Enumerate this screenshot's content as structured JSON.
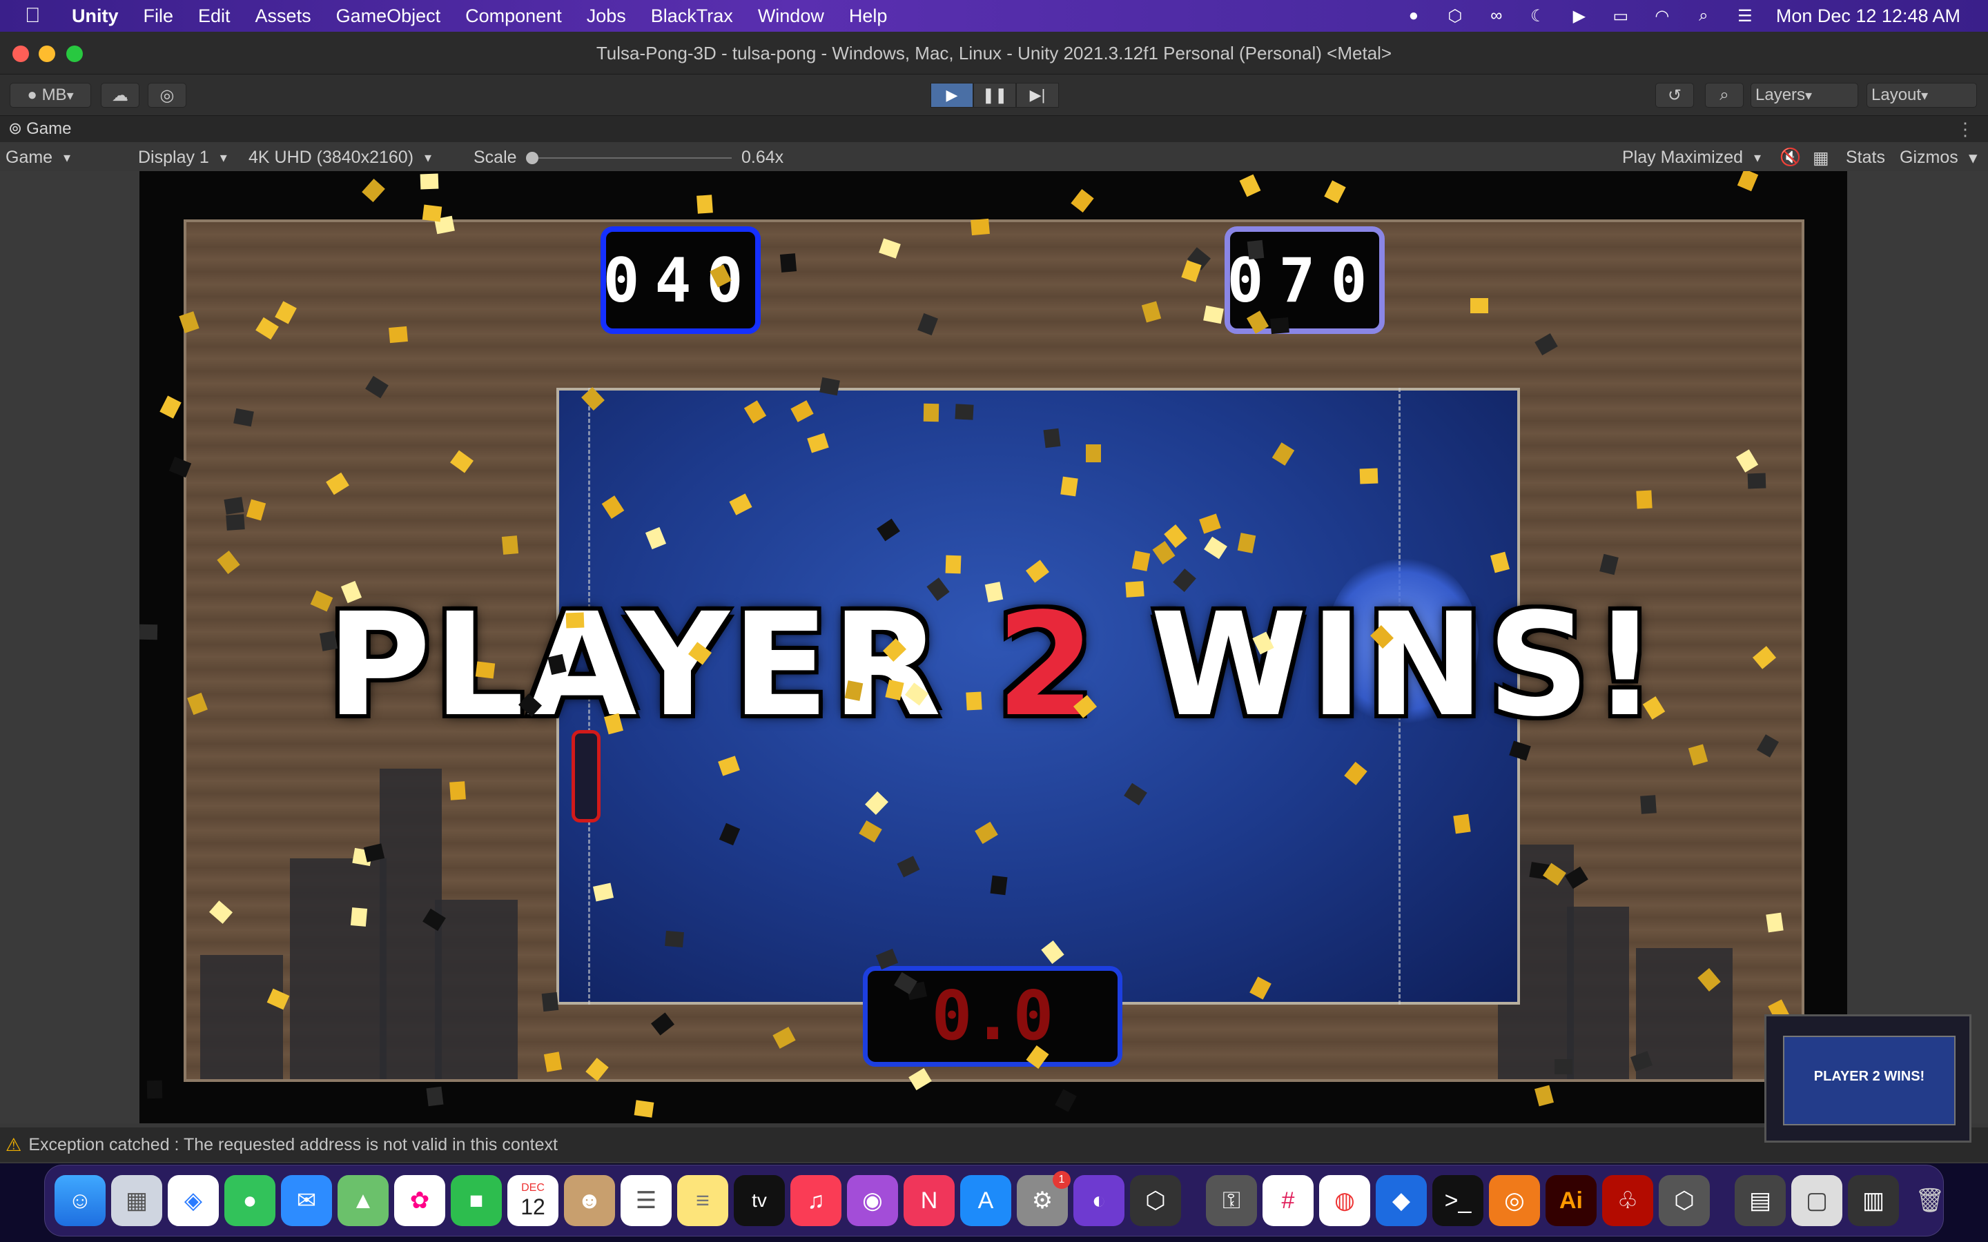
{
  "menubar": {
    "app": "Unity",
    "items": [
      "File",
      "Edit",
      "Assets",
      "GameObject",
      "Component",
      "Jobs",
      "BlackTrax",
      "Window",
      "Help"
    ],
    "clock": "Mon Dec 12  12:48 AM"
  },
  "window": {
    "title": "Tulsa-Pong-3D - tulsa-pong - Windows, Mac, Linux - Unity 2021.3.12f1 Personal (Personal) <Metal>"
  },
  "toolbar": {
    "account": "MB",
    "layers": "Layers",
    "layout": "Layout"
  },
  "tabs": {
    "game": "Game"
  },
  "gamebar": {
    "view": "Game",
    "display": "Display 1",
    "resolution": "4K UHD (3840x2160)",
    "scale_label": "Scale",
    "scale_value": "0.64x",
    "play_mode": "Play Maximized",
    "stats": "Stats",
    "gizmos": "Gizmos"
  },
  "game": {
    "player1_score": "040",
    "player2_score": "070",
    "timer": "0.0",
    "banner_before": "PLAYER ",
    "banner_num": "2",
    "banner_after": " WINS!"
  },
  "status": {
    "message": "Exception catched : The requested address is not valid in this context"
  },
  "preview": {
    "text": "PLAYER 2 WINS!"
  },
  "dock": {
    "apps": [
      "finder-icon",
      "launchpad-icon",
      "safari-icon",
      "messages-icon",
      "mail-icon",
      "maps-icon",
      "photos-icon",
      "facetime-icon",
      "calendar-icon",
      "contacts-icon",
      "reminders-icon",
      "notes-icon",
      "tv-icon",
      "music-icon",
      "podcasts-icon",
      "news-icon",
      "app-store-icon",
      "system-preferences-icon",
      "github-icon",
      "unity-hub-icon",
      "keychain-icon",
      "slack-icon",
      "chrome-icon",
      "blackmagic-icon",
      "terminal-icon",
      "blender-icon",
      "illustrator-icon",
      "acrobat-icon",
      "unity-icon",
      "downloads-icon",
      "documents-icon",
      "recents-icon",
      "trash-icon"
    ],
    "calendar_month": "DEC",
    "calendar_day": "12",
    "tv_label": "tv",
    "ai_label": "Ai",
    "settings_badge": "1"
  }
}
